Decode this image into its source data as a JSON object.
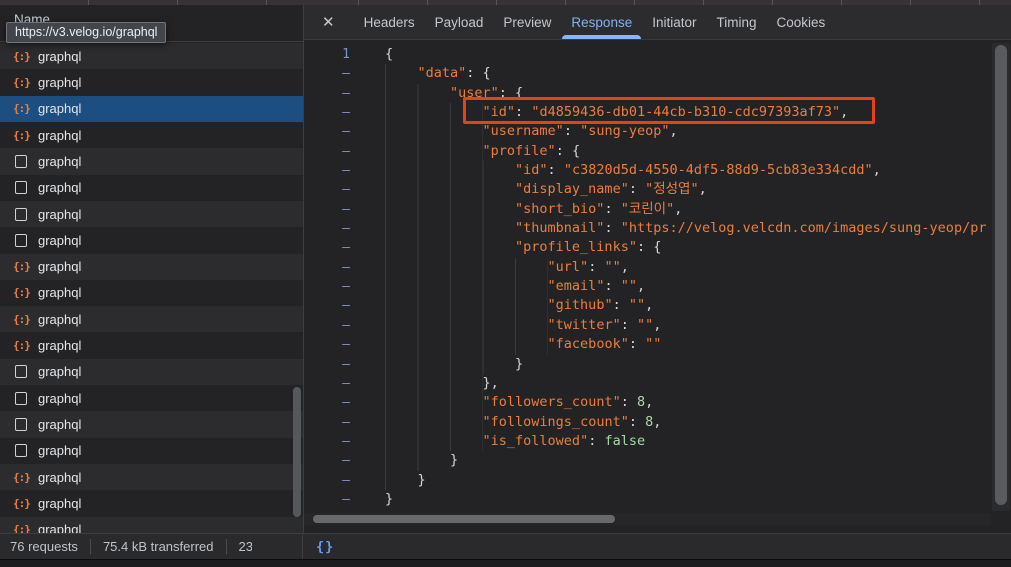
{
  "tooltip": {
    "text": "https://v3.velog.io/graphql"
  },
  "network_panel": {
    "column_header": "Name",
    "requests": [
      {
        "name": "graphql",
        "icon": "json",
        "selected": false
      },
      {
        "name": "graphql",
        "icon": "json",
        "selected": false
      },
      {
        "name": "graphql",
        "icon": "json",
        "selected": true
      },
      {
        "name": "graphql",
        "icon": "json",
        "selected": false
      },
      {
        "name": "graphql",
        "icon": "document",
        "selected": false
      },
      {
        "name": "graphql",
        "icon": "document",
        "selected": false
      },
      {
        "name": "graphql",
        "icon": "document",
        "selected": false
      },
      {
        "name": "graphql",
        "icon": "document",
        "selected": false
      },
      {
        "name": "graphql",
        "icon": "json",
        "selected": false
      },
      {
        "name": "graphql",
        "icon": "json",
        "selected": false
      },
      {
        "name": "graphql",
        "icon": "json",
        "selected": false
      },
      {
        "name": "graphql",
        "icon": "json",
        "selected": false
      },
      {
        "name": "graphql",
        "icon": "document",
        "selected": false
      },
      {
        "name": "graphql",
        "icon": "document",
        "selected": false
      },
      {
        "name": "graphql",
        "icon": "document",
        "selected": false
      },
      {
        "name": "graphql",
        "icon": "document",
        "selected": false
      },
      {
        "name": "graphql",
        "icon": "json",
        "selected": false
      },
      {
        "name": "graphql",
        "icon": "json",
        "selected": false
      },
      {
        "name": "graphql",
        "icon": "json",
        "selected": false
      }
    ],
    "summary": {
      "requests": "76 requests",
      "transferred": "75.4 kB transferred",
      "resources_clipped": "23"
    }
  },
  "detail_panel": {
    "close_label": "✕",
    "tabs": [
      "Headers",
      "Payload",
      "Preview",
      "Response",
      "Initiator",
      "Timing",
      "Cookies"
    ],
    "active_tab": "Response",
    "format_button": "{}"
  },
  "response_viewer": {
    "highlight_color": "#e34317",
    "highlighted_line": 4,
    "lines": [
      {
        "gutter": "1",
        "indent": 0,
        "tokens": [
          [
            "p",
            "{"
          ]
        ]
      },
      {
        "gutter": "–",
        "indent": 4,
        "tokens": [
          [
            "k",
            "\"data\""
          ],
          [
            "p",
            ": {"
          ]
        ]
      },
      {
        "gutter": "–",
        "indent": 8,
        "tokens": [
          [
            "k",
            "\"user\""
          ],
          [
            "p",
            ": {"
          ]
        ]
      },
      {
        "gutter": "–",
        "indent": 12,
        "tokens": [
          [
            "k",
            "\"id\""
          ],
          [
            "p",
            ": "
          ],
          [
            "s",
            "\"d4859436-db01-44cb-b310-cdc97393af73\""
          ],
          [
            "p",
            ","
          ]
        ],
        "highlight": true
      },
      {
        "gutter": "–",
        "indent": 12,
        "tokens": [
          [
            "k",
            "\"username\""
          ],
          [
            "p",
            ": "
          ],
          [
            "s",
            "\"sung-yeop\""
          ],
          [
            "p",
            ","
          ]
        ]
      },
      {
        "gutter": "–",
        "indent": 12,
        "tokens": [
          [
            "k",
            "\"profile\""
          ],
          [
            "p",
            ": {"
          ]
        ]
      },
      {
        "gutter": "–",
        "indent": 16,
        "tokens": [
          [
            "k",
            "\"id\""
          ],
          [
            "p",
            ": "
          ],
          [
            "s",
            "\"c3820d5d-4550-4df5-88d9-5cb83e334cdd\""
          ],
          [
            "p",
            ","
          ]
        ]
      },
      {
        "gutter": "–",
        "indent": 16,
        "tokens": [
          [
            "k",
            "\"display_name\""
          ],
          [
            "p",
            ": "
          ],
          [
            "s",
            "\"정성엽\""
          ],
          [
            "p",
            ","
          ]
        ]
      },
      {
        "gutter": "–",
        "indent": 16,
        "tokens": [
          [
            "k",
            "\"short_bio\""
          ],
          [
            "p",
            ": "
          ],
          [
            "s",
            "\"코린이\""
          ],
          [
            "p",
            ","
          ]
        ]
      },
      {
        "gutter": "–",
        "indent": 16,
        "tokens": [
          [
            "k",
            "\"thumbnail\""
          ],
          [
            "p",
            ": "
          ],
          [
            "s",
            "\"https://velog.velcdn.com/images/sung-yeop/pr"
          ]
        ]
      },
      {
        "gutter": "–",
        "indent": 16,
        "tokens": [
          [
            "k",
            "\"profile_links\""
          ],
          [
            "p",
            ": {"
          ]
        ]
      },
      {
        "gutter": "–",
        "indent": 20,
        "tokens": [
          [
            "k",
            "\"url\""
          ],
          [
            "p",
            ": "
          ],
          [
            "s",
            "\"\""
          ],
          [
            "p",
            ","
          ]
        ]
      },
      {
        "gutter": "–",
        "indent": 20,
        "tokens": [
          [
            "k",
            "\"email\""
          ],
          [
            "p",
            ": "
          ],
          [
            "s",
            "\"\""
          ],
          [
            "p",
            ","
          ]
        ]
      },
      {
        "gutter": "–",
        "indent": 20,
        "tokens": [
          [
            "k",
            "\"github\""
          ],
          [
            "p",
            ": "
          ],
          [
            "s",
            "\"\""
          ],
          [
            "p",
            ","
          ]
        ]
      },
      {
        "gutter": "–",
        "indent": 20,
        "tokens": [
          [
            "k",
            "\"twitter\""
          ],
          [
            "p",
            ": "
          ],
          [
            "s",
            "\"\""
          ],
          [
            "p",
            ","
          ]
        ]
      },
      {
        "gutter": "–",
        "indent": 20,
        "tokens": [
          [
            "k",
            "\"facebook\""
          ],
          [
            "p",
            ": "
          ],
          [
            "s",
            "\"\""
          ]
        ]
      },
      {
        "gutter": "–",
        "indent": 16,
        "tokens": [
          [
            "p",
            "}"
          ]
        ]
      },
      {
        "gutter": "–",
        "indent": 12,
        "tokens": [
          [
            "p",
            "},"
          ]
        ]
      },
      {
        "gutter": "–",
        "indent": 12,
        "tokens": [
          [
            "k",
            "\"followers_count\""
          ],
          [
            "p",
            ": "
          ],
          [
            "n",
            "8"
          ],
          [
            "p",
            ","
          ]
        ]
      },
      {
        "gutter": "–",
        "indent": 12,
        "tokens": [
          [
            "k",
            "\"followings_count\""
          ],
          [
            "p",
            ": "
          ],
          [
            "n",
            "8"
          ],
          [
            "p",
            ","
          ]
        ]
      },
      {
        "gutter": "–",
        "indent": 12,
        "tokens": [
          [
            "k",
            "\"is_followed\""
          ],
          [
            "p",
            ": "
          ],
          [
            "b",
            "false"
          ]
        ]
      },
      {
        "gutter": "–",
        "indent": 8,
        "tokens": [
          [
            "p",
            "}"
          ]
        ]
      },
      {
        "gutter": "–",
        "indent": 4,
        "tokens": [
          [
            "p",
            "}"
          ]
        ]
      },
      {
        "gutter": "–",
        "indent": 0,
        "tokens": [
          [
            "p",
            "}"
          ]
        ]
      }
    ]
  },
  "colors": {
    "accent_blue": "#8ab4f8",
    "code_orange": "#ea7e41",
    "code_green": "#a8d8a8",
    "selected_row_blue": "#1d4e81",
    "json_icon_orange": "#ed8043",
    "highlight_border": "#e34317"
  }
}
